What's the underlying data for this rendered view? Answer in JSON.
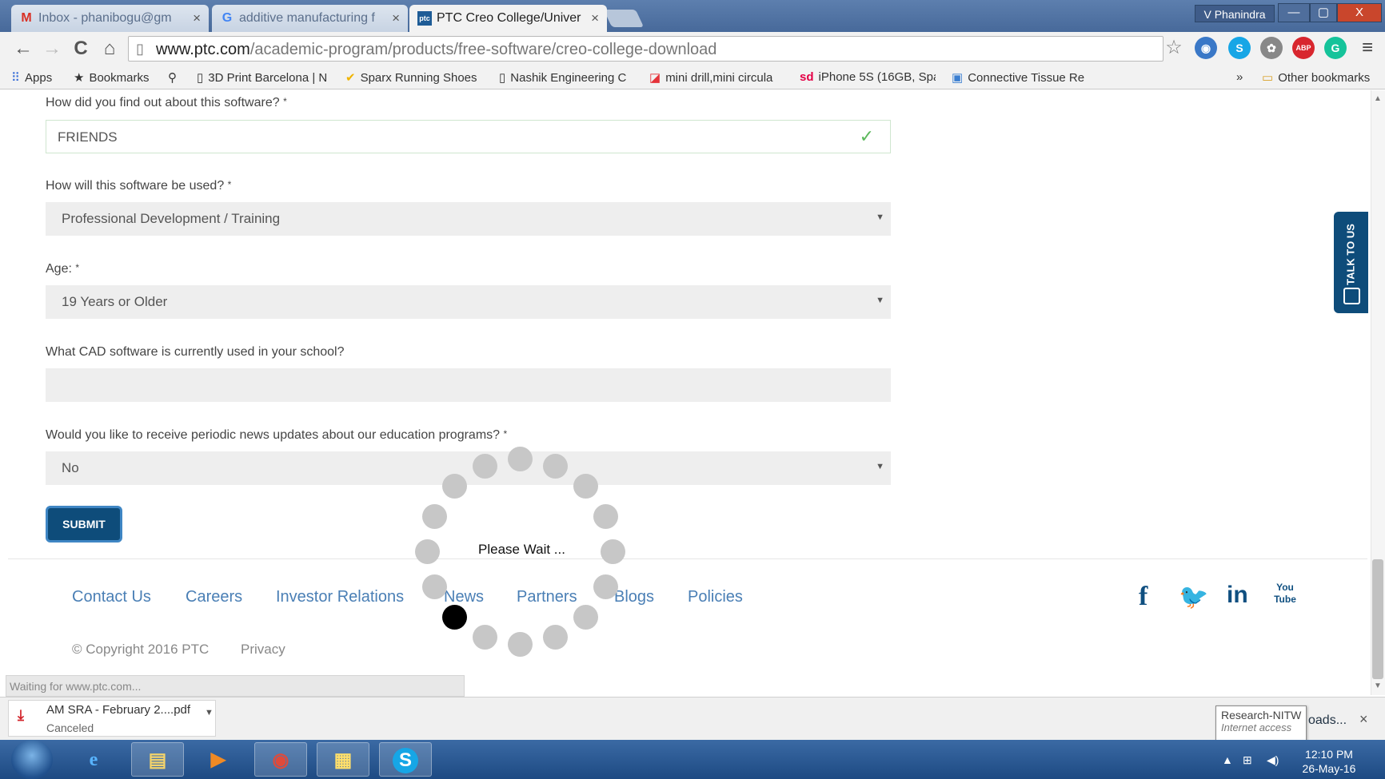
{
  "browser": {
    "tabs": [
      {
        "icon": "M",
        "label": "Inbox - phanibogu@gm",
        "active": false
      },
      {
        "icon": "G",
        "label": "additive manufacturing f",
        "active": false
      },
      {
        "icon": "ptc",
        "label": "PTC Creo College/Univer",
        "active": true
      }
    ],
    "user": "V Phanindra",
    "window_buttons": {
      "minimize": "—",
      "maximize": "▢",
      "close": "X"
    },
    "nav": {
      "back": "←",
      "forward": "→",
      "reload": "C",
      "home": "⌂"
    },
    "url_domain": "www.ptc.com",
    "url_path": "/academic-program/products/free-software/creo-college-download",
    "extensions": [
      "star-icon",
      "globe-icon",
      "skype-icon",
      "puzzle-icon",
      "adblock-icon",
      "grammarly-icon",
      "menu-icon"
    ],
    "ext_labels": {
      "star": "☆",
      "globe": "◉",
      "skype": "S",
      "puzzle": "✿",
      "adblock": "ABP",
      "grammarly": "G",
      "menu": "≡"
    },
    "bookmarks": [
      {
        "icon": "apps-icon",
        "glyph": "⠿",
        "label": "Apps"
      },
      {
        "icon": "star-icon",
        "glyph": "★",
        "label": "Bookmarks"
      },
      {
        "icon": "search-icon",
        "glyph": "⚲",
        "label": ""
      },
      {
        "icon": "page-icon",
        "glyph": "▯",
        "label": "3D Print Barcelona | N"
      },
      {
        "icon": "shoe-icon",
        "glyph": "✔",
        "label": "Sparx Running Shoes"
      },
      {
        "icon": "page-icon",
        "glyph": "▯",
        "label": "Nashik Engineering C"
      },
      {
        "icon": "pocket-icon",
        "glyph": "◪",
        "label": "mini drill,mini circula"
      },
      {
        "icon": "snapdeal-icon",
        "glyph": "sd",
        "label": "iPhone 5S (16GB, Spa"
      },
      {
        "icon": "image-icon",
        "glyph": "▣",
        "label": "Connective Tissue Re"
      }
    ],
    "bookmarks_more": "»",
    "other_bookmarks": "Other bookmarks",
    "other_bookmarks_icon": "▭"
  },
  "form": {
    "q1_label": "How did you find out about this software?",
    "q1_value": "FRIENDS",
    "q2_label": "How will this software be used?",
    "q2_value": "Professional Development / Training",
    "q3_label": "Age:",
    "q3_value": "19 Years or Older",
    "q4_label": "What CAD software is currently used in your school?",
    "q4_value": "",
    "q5_label": "Would you like to receive periodic news updates about our education programs?",
    "q5_value": "No",
    "required_mark": "*",
    "check_mark": "✓",
    "caret": "▼",
    "submit_label": "SUBMIT"
  },
  "footer": {
    "links": [
      "Contact Us",
      "Careers",
      "Investor Relations",
      "News",
      "Partners",
      "Blogs",
      "Policies"
    ],
    "copyright": "© Copyright 2016 PTC",
    "privacy": "Privacy",
    "social": {
      "facebook": "f",
      "twitter": "🐦",
      "linkedin": "in",
      "youtube": "You Tube"
    }
  },
  "talk_to_us": "TALK TO US",
  "spinner": {
    "message": "Please Wait ...",
    "active_index": 10
  },
  "status_text": "Waiting for www.ptc.com...",
  "downloads": {
    "file_name": "AM SRA - February 2....pdf",
    "file_status": "Canceled",
    "show_all": "Show all downloads...",
    "show_all_visible": "oads...",
    "close": "×",
    "tooltip_title": "Research-NITW",
    "tooltip_sub": "Internet access"
  },
  "taskbar": {
    "apps": [
      {
        "name": "ie-icon",
        "glyph": "e",
        "color": "#58b4ff"
      },
      {
        "name": "explorer-icon",
        "glyph": "▤",
        "color": "#f3d36b"
      },
      {
        "name": "media-player-icon",
        "glyph": "▶",
        "color": "#f08a24"
      },
      {
        "name": "chrome-icon",
        "glyph": "◉",
        "color": "#e04a3a"
      },
      {
        "name": "app-grid-icon",
        "glyph": "▦",
        "color": "#ffffff"
      },
      {
        "name": "skype-taskbar-icon",
        "glyph": "S",
        "color": "#ffffff"
      }
    ],
    "time": "12:10 PM",
    "date": "26-May-16"
  }
}
